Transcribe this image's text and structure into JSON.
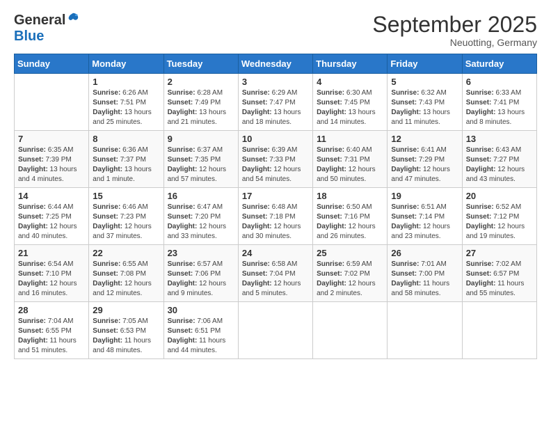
{
  "header": {
    "logo_general": "General",
    "logo_blue": "Blue",
    "month_title": "September 2025",
    "location": "Neuotting, Germany"
  },
  "days_of_week": [
    "Sunday",
    "Monday",
    "Tuesday",
    "Wednesday",
    "Thursday",
    "Friday",
    "Saturday"
  ],
  "weeks": [
    [
      {
        "day": "",
        "sunrise": "",
        "sunset": "",
        "daylight": ""
      },
      {
        "day": "1",
        "sunrise": "6:26 AM",
        "sunset": "7:51 PM",
        "daylight": "13 hours and 25 minutes."
      },
      {
        "day": "2",
        "sunrise": "6:28 AM",
        "sunset": "7:49 PM",
        "daylight": "13 hours and 21 minutes."
      },
      {
        "day": "3",
        "sunrise": "6:29 AM",
        "sunset": "7:47 PM",
        "daylight": "13 hours and 18 minutes."
      },
      {
        "day": "4",
        "sunrise": "6:30 AM",
        "sunset": "7:45 PM",
        "daylight": "13 hours and 14 minutes."
      },
      {
        "day": "5",
        "sunrise": "6:32 AM",
        "sunset": "7:43 PM",
        "daylight": "13 hours and 11 minutes."
      },
      {
        "day": "6",
        "sunrise": "6:33 AM",
        "sunset": "7:41 PM",
        "daylight": "13 hours and 8 minutes."
      }
    ],
    [
      {
        "day": "7",
        "sunrise": "6:35 AM",
        "sunset": "7:39 PM",
        "daylight": "13 hours and 4 minutes."
      },
      {
        "day": "8",
        "sunrise": "6:36 AM",
        "sunset": "7:37 PM",
        "daylight": "13 hours and 1 minute."
      },
      {
        "day": "9",
        "sunrise": "6:37 AM",
        "sunset": "7:35 PM",
        "daylight": "12 hours and 57 minutes."
      },
      {
        "day": "10",
        "sunrise": "6:39 AM",
        "sunset": "7:33 PM",
        "daylight": "12 hours and 54 minutes."
      },
      {
        "day": "11",
        "sunrise": "6:40 AM",
        "sunset": "7:31 PM",
        "daylight": "12 hours and 50 minutes."
      },
      {
        "day": "12",
        "sunrise": "6:41 AM",
        "sunset": "7:29 PM",
        "daylight": "12 hours and 47 minutes."
      },
      {
        "day": "13",
        "sunrise": "6:43 AM",
        "sunset": "7:27 PM",
        "daylight": "12 hours and 43 minutes."
      }
    ],
    [
      {
        "day": "14",
        "sunrise": "6:44 AM",
        "sunset": "7:25 PM",
        "daylight": "12 hours and 40 minutes."
      },
      {
        "day": "15",
        "sunrise": "6:46 AM",
        "sunset": "7:23 PM",
        "daylight": "12 hours and 37 minutes."
      },
      {
        "day": "16",
        "sunrise": "6:47 AM",
        "sunset": "7:20 PM",
        "daylight": "12 hours and 33 minutes."
      },
      {
        "day": "17",
        "sunrise": "6:48 AM",
        "sunset": "7:18 PM",
        "daylight": "12 hours and 30 minutes."
      },
      {
        "day": "18",
        "sunrise": "6:50 AM",
        "sunset": "7:16 PM",
        "daylight": "12 hours and 26 minutes."
      },
      {
        "day": "19",
        "sunrise": "6:51 AM",
        "sunset": "7:14 PM",
        "daylight": "12 hours and 23 minutes."
      },
      {
        "day": "20",
        "sunrise": "6:52 AM",
        "sunset": "7:12 PM",
        "daylight": "12 hours and 19 minutes."
      }
    ],
    [
      {
        "day": "21",
        "sunrise": "6:54 AM",
        "sunset": "7:10 PM",
        "daylight": "12 hours and 16 minutes."
      },
      {
        "day": "22",
        "sunrise": "6:55 AM",
        "sunset": "7:08 PM",
        "daylight": "12 hours and 12 minutes."
      },
      {
        "day": "23",
        "sunrise": "6:57 AM",
        "sunset": "7:06 PM",
        "daylight": "12 hours and 9 minutes."
      },
      {
        "day": "24",
        "sunrise": "6:58 AM",
        "sunset": "7:04 PM",
        "daylight": "12 hours and 5 minutes."
      },
      {
        "day": "25",
        "sunrise": "6:59 AM",
        "sunset": "7:02 PM",
        "daylight": "12 hours and 2 minutes."
      },
      {
        "day": "26",
        "sunrise": "7:01 AM",
        "sunset": "7:00 PM",
        "daylight": "11 hours and 58 minutes."
      },
      {
        "day": "27",
        "sunrise": "7:02 AM",
        "sunset": "6:57 PM",
        "daylight": "11 hours and 55 minutes."
      }
    ],
    [
      {
        "day": "28",
        "sunrise": "7:04 AM",
        "sunset": "6:55 PM",
        "daylight": "11 hours and 51 minutes."
      },
      {
        "day": "29",
        "sunrise": "7:05 AM",
        "sunset": "6:53 PM",
        "daylight": "11 hours and 48 minutes."
      },
      {
        "day": "30",
        "sunrise": "7:06 AM",
        "sunset": "6:51 PM",
        "daylight": "11 hours and 44 minutes."
      },
      {
        "day": "",
        "sunrise": "",
        "sunset": "",
        "daylight": ""
      },
      {
        "day": "",
        "sunrise": "",
        "sunset": "",
        "daylight": ""
      },
      {
        "day": "",
        "sunrise": "",
        "sunset": "",
        "daylight": ""
      },
      {
        "day": "",
        "sunrise": "",
        "sunset": "",
        "daylight": ""
      }
    ]
  ],
  "labels": {
    "sunrise": "Sunrise:",
    "sunset": "Sunset:",
    "daylight": "Daylight:"
  }
}
